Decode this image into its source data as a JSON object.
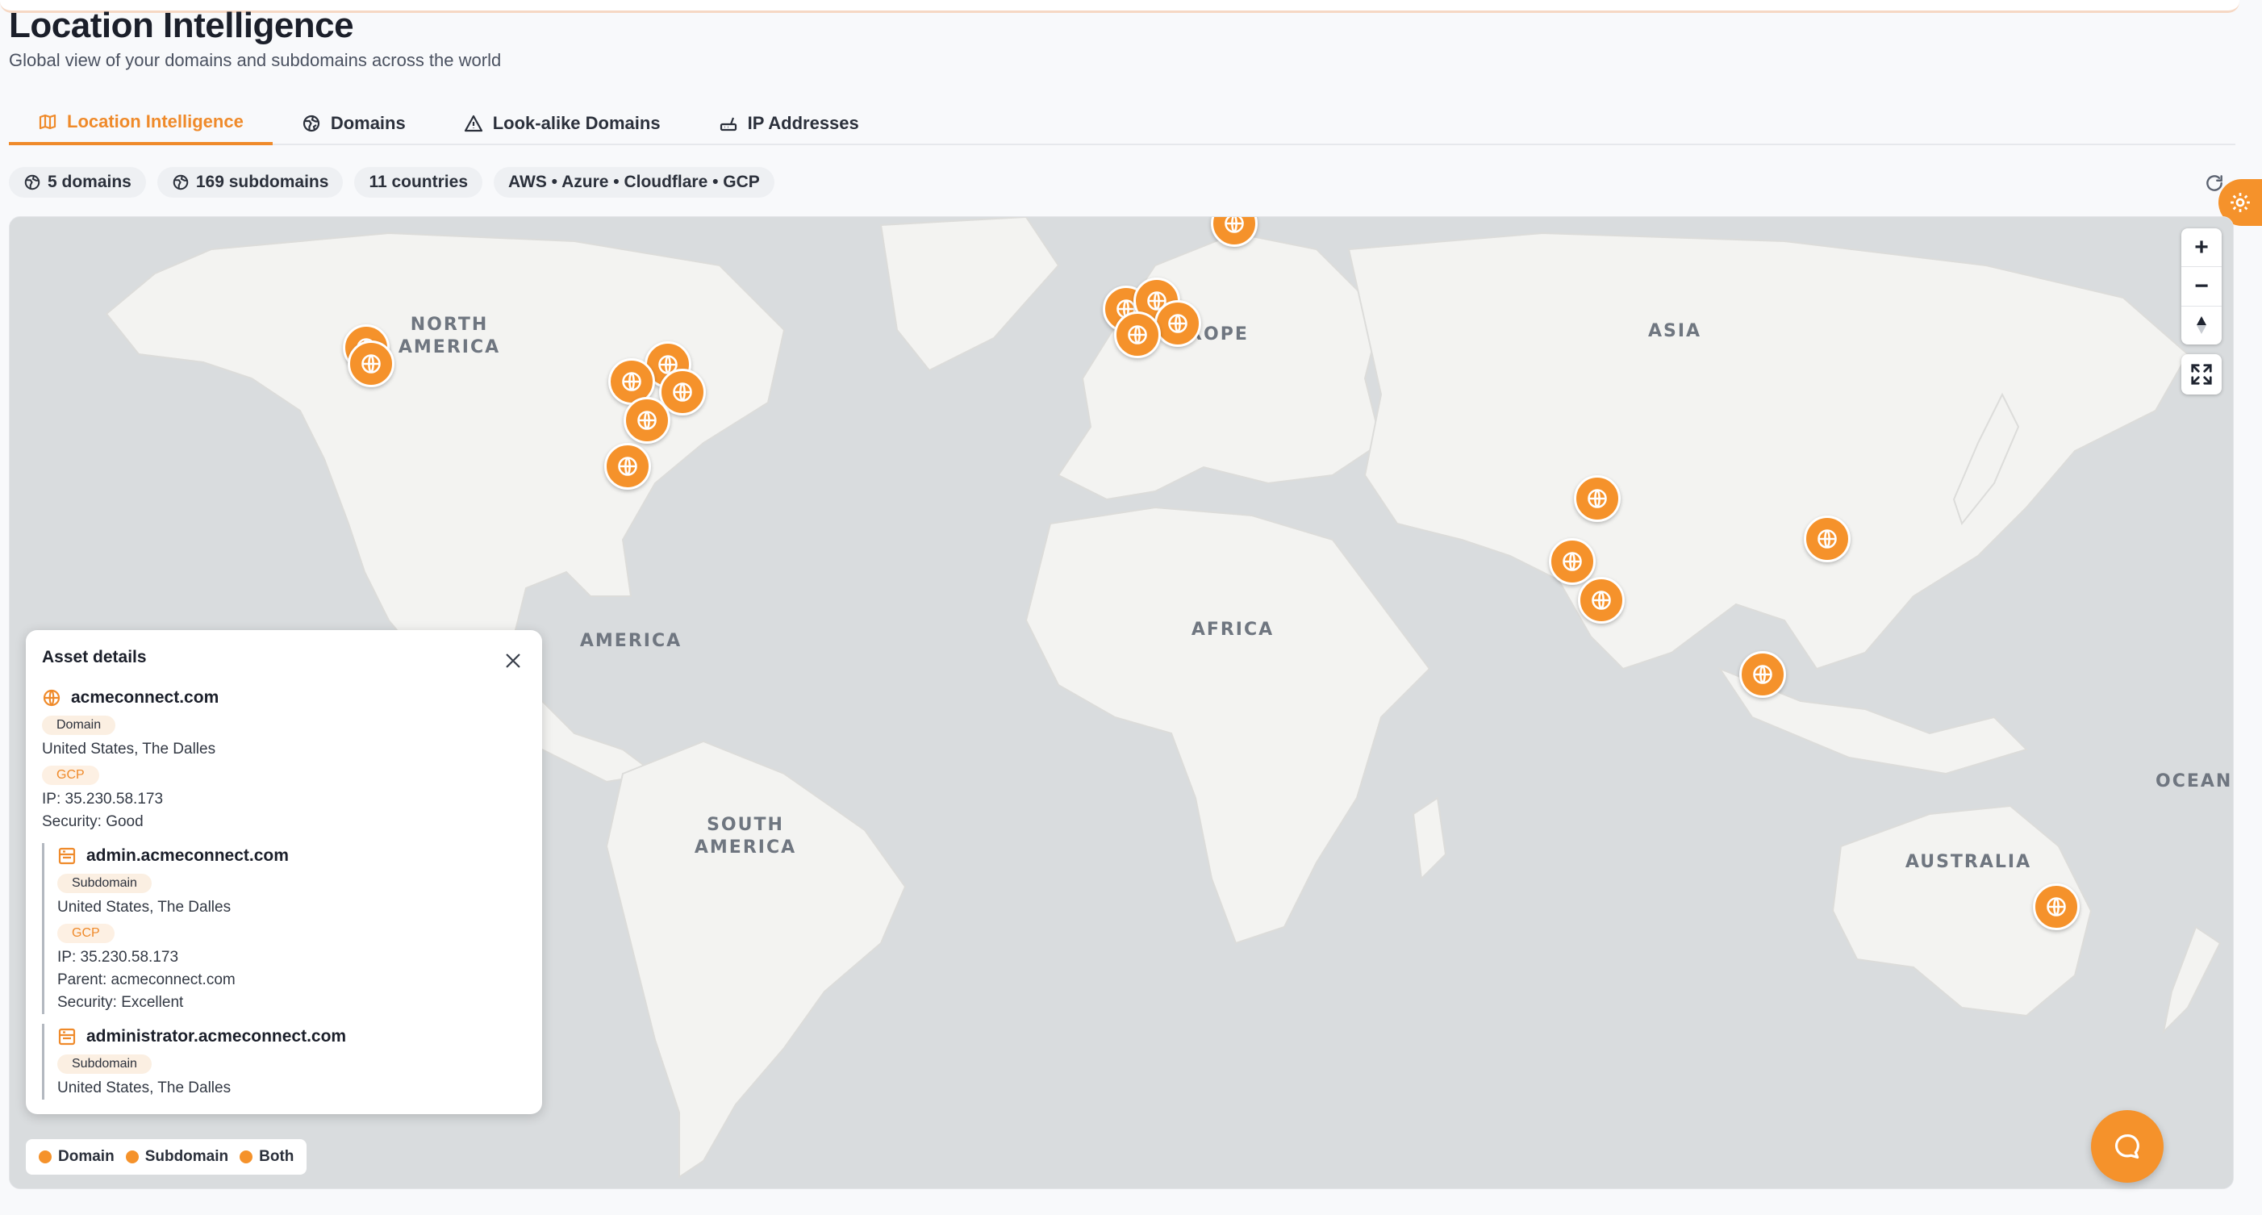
{
  "page": {
    "title": "Location Intelligence",
    "subtitle": "Global view of your domains and subdomains across the world"
  },
  "tabs": [
    {
      "label": "Location Intelligence",
      "icon": "map-icon",
      "active": true
    },
    {
      "label": "Domains",
      "icon": "globe-icon",
      "active": false
    },
    {
      "label": "Look-alike Domains",
      "icon": "warning-icon",
      "active": false
    },
    {
      "label": "IP Addresses",
      "icon": "router-icon",
      "active": false
    }
  ],
  "stats": {
    "domains": "5 domains",
    "subdomains": "169 subdomains",
    "countries": "11 countries",
    "providers": "AWS • Azure • Cloudflare • GCP"
  },
  "map": {
    "regions": {
      "north_america": [
        "NORTH",
        "AMERICA"
      ],
      "america": "AMERICA",
      "south_america": [
        "SOUTH",
        "AMERICA"
      ],
      "europe": "EUROPE",
      "asia": "ASIA",
      "africa": "AFRICA",
      "australia": "AUSTRALIA",
      "oceania": "OCEANIA"
    },
    "zoom_in_label": "+",
    "zoom_out_label": "−",
    "marker_icon": "globe-icon"
  },
  "asset_details": {
    "title": "Asset details",
    "domain": {
      "name": "acmeconnect.com",
      "type": "Domain",
      "location": "United States, The Dalles",
      "provider": "GCP",
      "ip": "IP: 35.230.58.173",
      "security": "Security: Good"
    },
    "subdomains": [
      {
        "name": "admin.acmeconnect.com",
        "type": "Subdomain",
        "location": "United States, The Dalles",
        "provider": "GCP",
        "ip": "IP: 35.230.58.173",
        "parent": "Parent: acmeconnect.com",
        "security": "Security: Excellent"
      },
      {
        "name": "administrator.acmeconnect.com",
        "type": "Subdomain",
        "location": "United States, The Dalles"
      }
    ]
  },
  "legend": {
    "domain": "Domain",
    "subdomain": "Subdomain",
    "both": "Both"
  },
  "colors": {
    "accent": "#f5922b",
    "map_water": "#d9dcde",
    "map_land": "#f3f3f1"
  }
}
